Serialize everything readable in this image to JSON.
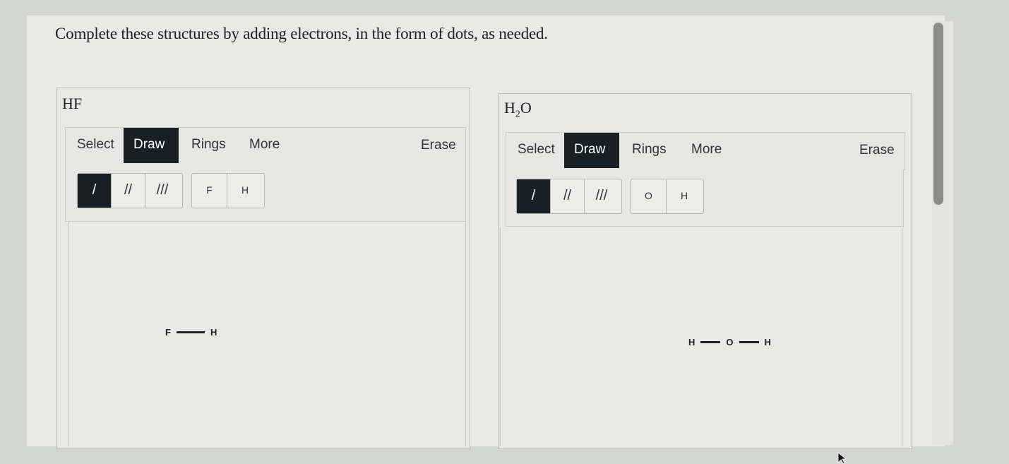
{
  "instruction": "Complete these structures by adding electrons, in the form of dots, as needed.",
  "panels": [
    {
      "title_main": "HF",
      "title_sub": "",
      "title_after": "",
      "toolbar": {
        "select": "Select",
        "draw": "Draw",
        "rings": "Rings",
        "more": "More",
        "erase": "Erase"
      },
      "bonds": [
        "/",
        "//",
        "///"
      ],
      "atoms": [
        "F",
        "H"
      ],
      "molecule": [
        "F",
        "H"
      ]
    },
    {
      "title_main": "H",
      "title_sub": "2",
      "title_after": "O",
      "toolbar": {
        "select": "Select",
        "draw": "Draw",
        "rings": "Rings",
        "more": "More",
        "erase": "Erase"
      },
      "bonds": [
        "/",
        "//",
        "///"
      ],
      "atoms": [
        "O",
        "H"
      ],
      "molecule": [
        "H",
        "O",
        "H"
      ]
    }
  ]
}
